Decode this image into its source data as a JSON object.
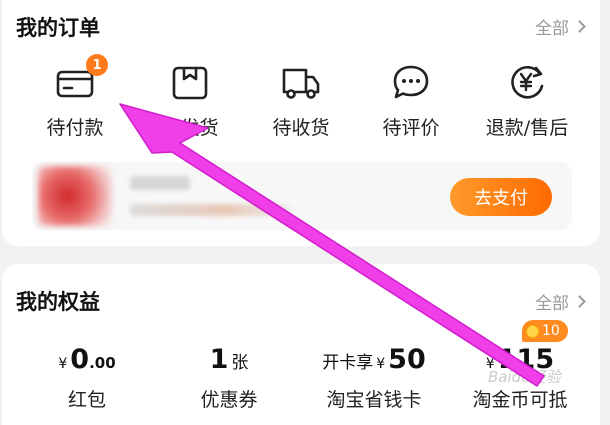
{
  "orders": {
    "title": "我的订单",
    "view_all": "全部",
    "items": [
      {
        "label": "待付款",
        "icon": "wallet-card-icon",
        "badge": "1"
      },
      {
        "label": "待发货",
        "icon": "package-box-icon"
      },
      {
        "label": "待收货",
        "icon": "delivery-truck-icon"
      },
      {
        "label": "待评价",
        "icon": "comment-bubble-icon"
      },
      {
        "label": "退款/售后",
        "icon": "refund-yuan-icon"
      }
    ],
    "pending_item": {
      "pay_button": "去支付"
    }
  },
  "benefits": {
    "title": "我的权益",
    "view_all": "全部",
    "items": [
      {
        "currency": "¥",
        "value_big": "0",
        "value_small": ".00",
        "label": "红包"
      },
      {
        "value_big": "1",
        "unit": "张",
        "label": "优惠券"
      },
      {
        "prefix": "开卡享",
        "currency": "¥",
        "value_big": "50",
        "label": "淘宝省钱卡"
      },
      {
        "currency": "¥",
        "value_big": "115",
        "label": "淘金币可抵",
        "coin_badge": "10"
      }
    ]
  },
  "colors": {
    "accent_orange": "#ff6a00",
    "annotation_arrow": "#f03ee8"
  },
  "watermark": "Baidu经验"
}
